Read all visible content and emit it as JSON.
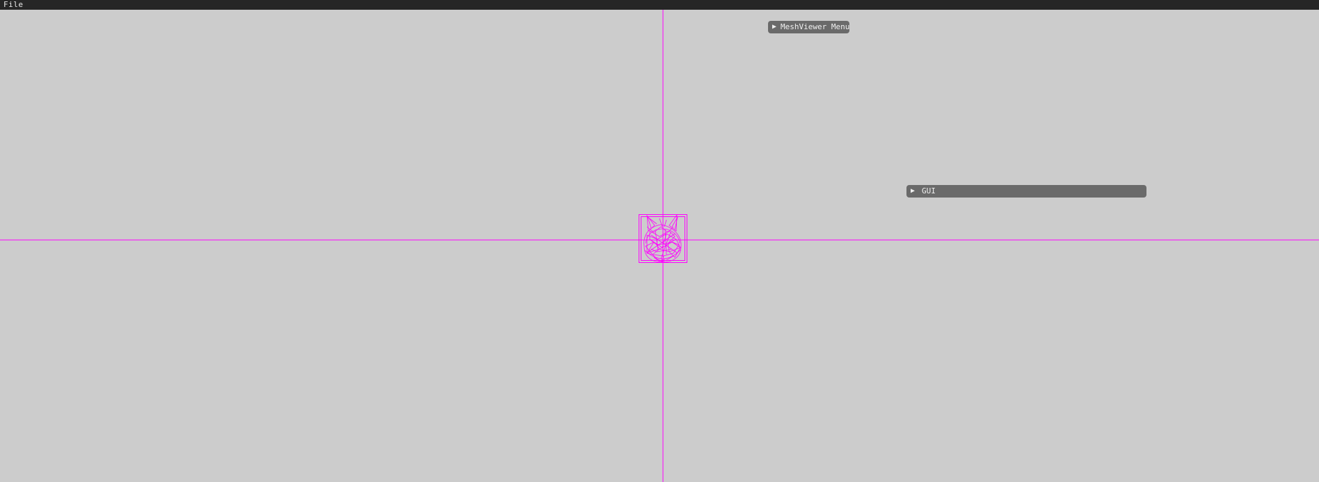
{
  "menubar": {
    "items": [
      {
        "label": "File"
      }
    ]
  },
  "windows": {
    "meshviewer": {
      "arrow": "▶",
      "title": "MeshViewer Menu"
    },
    "gui": {
      "arrow": "▶",
      "title": "GUI"
    }
  },
  "scene": {
    "axis_color": "#ff00ff",
    "mesh_color": "#ff00ff",
    "background_color": "#cccccc",
    "object": "wireframe-bunny-mesh"
  }
}
